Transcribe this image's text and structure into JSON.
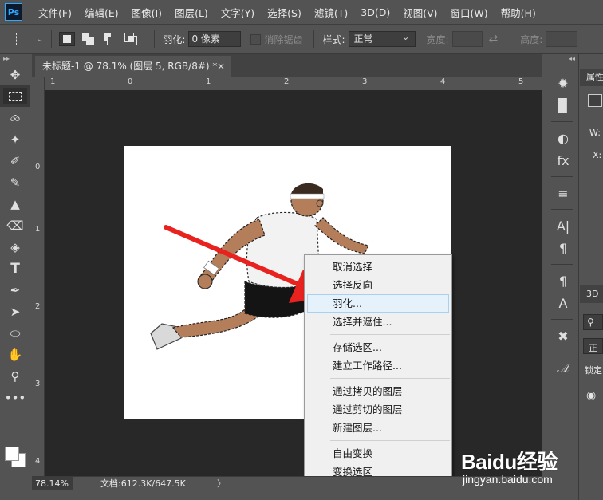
{
  "app": {
    "logo": "Ps"
  },
  "menu": [
    "文件(F)",
    "编辑(E)",
    "图像(I)",
    "图层(L)",
    "文字(Y)",
    "选择(S)",
    "滤镜(T)",
    "3D(D)",
    "视图(V)",
    "窗口(W)",
    "帮助(H)"
  ],
  "options": {
    "feather_label": "羽化:",
    "feather_value": "0 像素",
    "antialias_label": "消除锯齿",
    "style_label": "样式:",
    "style_value": "正常",
    "width_label": "宽度:",
    "height_label": "高度:"
  },
  "document": {
    "tab_title": "未标题-1 @ 78.1% (图层 5, RGB/8#) *",
    "close_glyph": "×"
  },
  "rulers": {
    "top": [
      "1",
      "0",
      "1",
      "2",
      "3",
      "4",
      "5"
    ],
    "left": [
      "0",
      "1",
      "2",
      "3",
      "4"
    ]
  },
  "context_menu": {
    "groups": [
      [
        "取消选择",
        "选择反向",
        "羽化...",
        "选择并遮住..."
      ],
      [
        "存储选区...",
        "建立工作路径..."
      ],
      [
        "通过拷贝的图层",
        "通过剪切的图层",
        "新建图层..."
      ],
      [
        "自由变换",
        "变换选区"
      ]
    ],
    "highlighted": "羽化..."
  },
  "status": {
    "zoom": "78.14%",
    "doc_info": "文档:612.3K/647.5K",
    "arrow": "〉"
  },
  "panels": {
    "properties_label": "属性",
    "w_label": "W:",
    "x_label": "X:",
    "tab_3d": "3D",
    "style_normal": "正",
    "lock_label": "锁定"
  },
  "tools": [
    "move-icon",
    "marquee-icon",
    "lasso-icon",
    "magic-wand-icon",
    "eyedropper-icon",
    "brush-icon",
    "stamp-icon",
    "eraser-icon",
    "gradient-icon",
    "type-icon",
    "pen-icon",
    "path-select-icon",
    "ellipse-icon",
    "hand-icon",
    "zoom-icon",
    "more-icon"
  ],
  "watermark": {
    "brand": "Baidu经验",
    "url": "jingyan.baidu.com"
  },
  "colors": {
    "ui_bg": "#535353",
    "workspace": "#282828",
    "canvas": "#ffffff",
    "arrow": "#e8231f",
    "menu_highlight": "#e5f1fb"
  }
}
